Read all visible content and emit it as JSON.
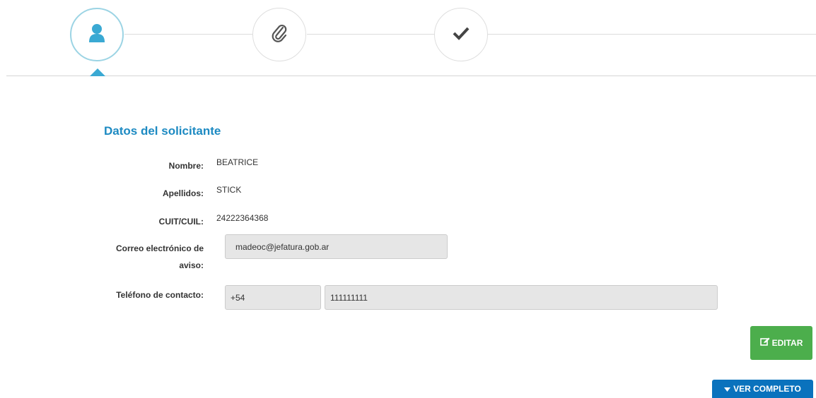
{
  "stepper": {
    "steps": [
      {
        "icon": "user-icon",
        "state": "active"
      },
      {
        "icon": "paperclip-icon",
        "state": "pending"
      },
      {
        "icon": "checkmark-icon",
        "state": "pending"
      }
    ],
    "active_color": "#3aa9d3"
  },
  "section": {
    "title": "Datos del solicitante"
  },
  "fields": {
    "nombre": {
      "label": "Nombre:",
      "value": "BEATRICE"
    },
    "apellidos": {
      "label": "Apellidos:",
      "value": "STICK"
    },
    "cuit": {
      "label": "CUIT/CUIL:",
      "value": "24222364368"
    },
    "correo": {
      "label_line1": "Correo electrónico de",
      "label_line2": "aviso:",
      "value": "madeoc@jefatura.gob.ar"
    },
    "telefono": {
      "label": "Teléfono de contacto:",
      "prefix": "+54",
      "number": "111111111"
    }
  },
  "buttons": {
    "editar": {
      "label": "EDITAR",
      "icon": "edit-icon",
      "color": "#4cae4c"
    },
    "ver_completo": {
      "label": "VER COMPLETO",
      "icon": "caret-down-icon",
      "color": "#0a72bd"
    }
  }
}
